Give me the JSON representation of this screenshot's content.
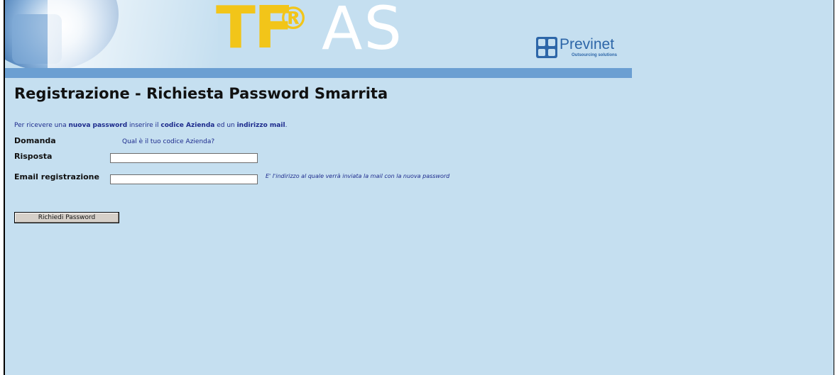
{
  "banner": {
    "logo_tf": "TF",
    "logo_registered": "®",
    "logo_as": "AS",
    "brand_name": "Previnet",
    "brand_tagline": "Outsourcing solutions",
    "icons": [
      "globe-puzzle-graphic",
      "previnet-logo-icon"
    ]
  },
  "page": {
    "title": "Registrazione - Richiesta Password Smarrita",
    "intro": {
      "part1": "Per ricevere una ",
      "bold1": "nuova password",
      "part2": " inserire il ",
      "bold2": "codice Azienda",
      "part3": " ed un ",
      "bold3": "indirizzo mail",
      "part4": "."
    }
  },
  "form": {
    "domanda_label": "Domanda",
    "domanda_value": "Qual è il tuo codice Azienda?",
    "risposta_label": "Risposta",
    "risposta_value": "",
    "email_label": "Email registrazione",
    "email_value": "",
    "email_hint": "E' l'indirizzo al quale verrà inviata la mail con la nuova password",
    "submit_label": "Richiedi Password"
  },
  "colors": {
    "background": "#c5dff0",
    "stripe": "#6b9fd2",
    "logo_yellow": "#f2c519",
    "text_blue": "#1c2a8c",
    "previnet_blue": "#2d66a8"
  }
}
